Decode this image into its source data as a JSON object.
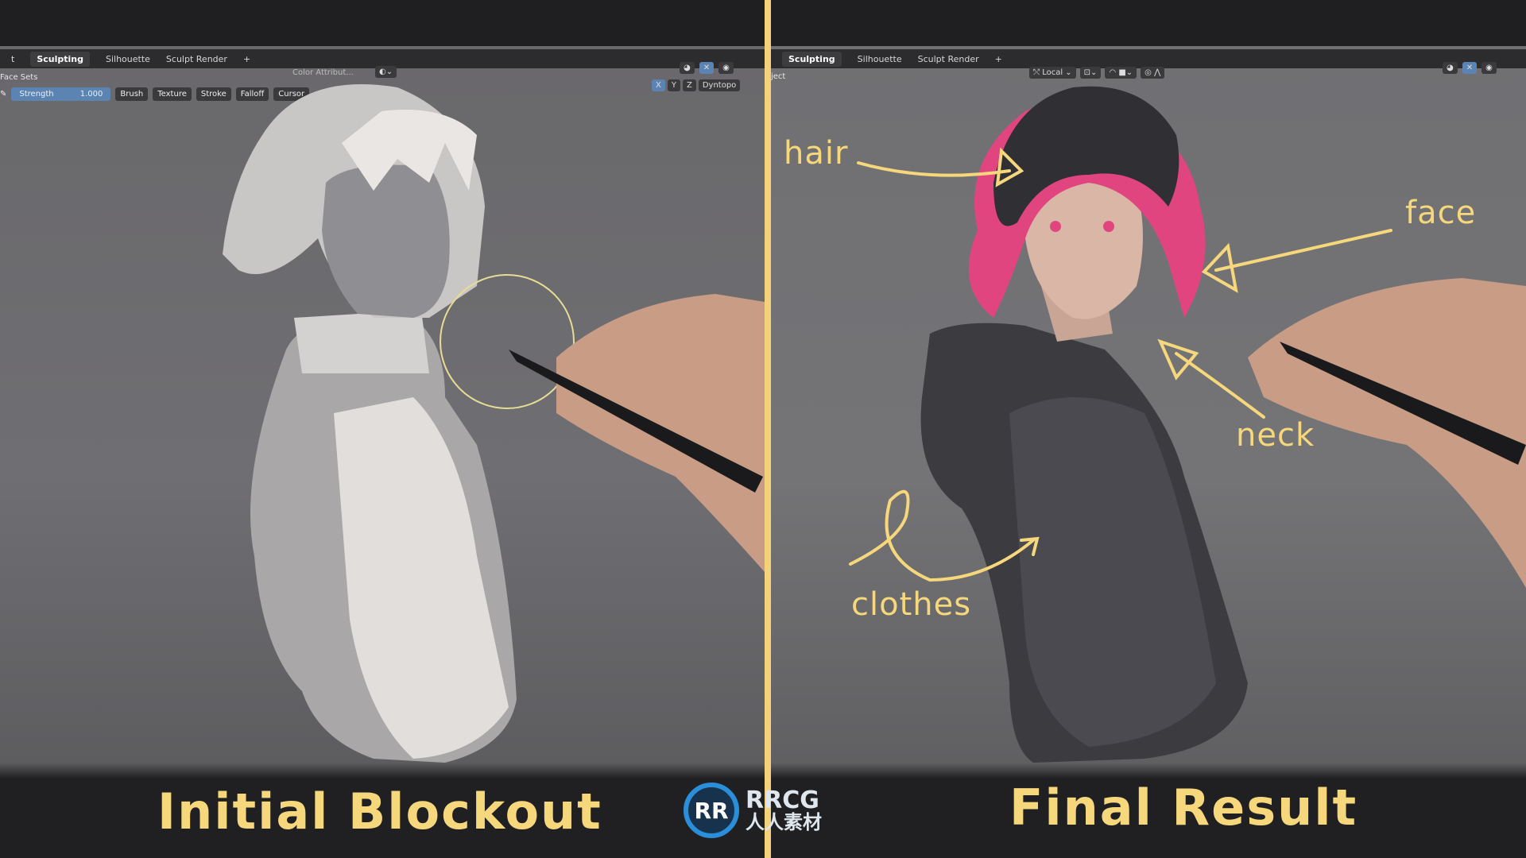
{
  "left": {
    "tabs": [
      "t",
      "Sculpting",
      "Silhouette",
      "Sculpt Render",
      "+"
    ],
    "active_tab": "Sculpting",
    "mode_label": "Face Sets",
    "color_attribute": "Color Attribut...",
    "strength_label": "Strength",
    "strength_value": "1.000",
    "dropdowns": [
      "Brush",
      "Texture",
      "Stroke",
      "Falloff",
      "Cursor"
    ],
    "axis_buttons": [
      "X",
      "Y",
      "Z"
    ],
    "dyntopo": "Dyntopo"
  },
  "right": {
    "tabs": [
      "Sculpting",
      "Silhouette",
      "Sculpt Render",
      "+"
    ],
    "active_tab": "Sculpting",
    "mode_label": "ject",
    "orientation": "Local"
  },
  "annotations": {
    "hair": "hair",
    "face": "face",
    "neck": "neck",
    "clothes": "clothes"
  },
  "captions": {
    "left": "Initial Blockout",
    "right": "Final Result"
  },
  "watermark": {
    "logo": "RR",
    "text": "RRCG",
    "subtext": "人人素材"
  },
  "colors": {
    "accent": "#f3d27a",
    "hair_pink": "#e0457f",
    "strength_bar": "#5b84b3"
  }
}
